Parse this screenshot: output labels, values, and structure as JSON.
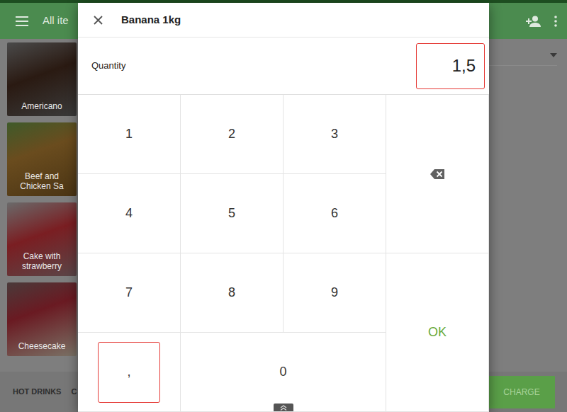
{
  "app_bar": {
    "title": "All ite"
  },
  "items": [
    {
      "name": "Americano"
    },
    {
      "name": "Beef and Chicken Sa"
    },
    {
      "name": "Cake with strawberry"
    },
    {
      "name": "Cheesecake"
    }
  ],
  "categories": [
    {
      "label": "HOT DRINKS"
    },
    {
      "label": "C"
    }
  ],
  "charge_button": {
    "label": "CHARGE"
  },
  "dialog": {
    "title": "Banana 1kg",
    "quantity": {
      "label": "Quantity",
      "value": "1,5",
      "highlighted": true
    },
    "keys": [
      {
        "label": "1",
        "kind": "digit",
        "highlighted": false
      },
      {
        "label": "2",
        "kind": "digit",
        "highlighted": false
      },
      {
        "label": "3",
        "kind": "digit",
        "highlighted": false
      },
      {
        "kind": "backspace",
        "highlighted": false
      },
      {
        "label": "4",
        "kind": "digit",
        "highlighted": false
      },
      {
        "label": "5",
        "kind": "digit",
        "highlighted": false
      },
      {
        "label": "6",
        "kind": "digit",
        "highlighted": false
      },
      {
        "label": "7",
        "kind": "digit",
        "highlighted": false
      },
      {
        "label": "8",
        "kind": "digit",
        "highlighted": false
      },
      {
        "label": "9",
        "kind": "digit",
        "highlighted": false
      },
      {
        "label": "OK",
        "kind": "ok",
        "highlighted": false
      },
      {
        "label": ",",
        "kind": "decimal",
        "highlighted": true
      },
      {
        "label": "0",
        "kind": "digit",
        "highlighted": false
      }
    ]
  }
}
